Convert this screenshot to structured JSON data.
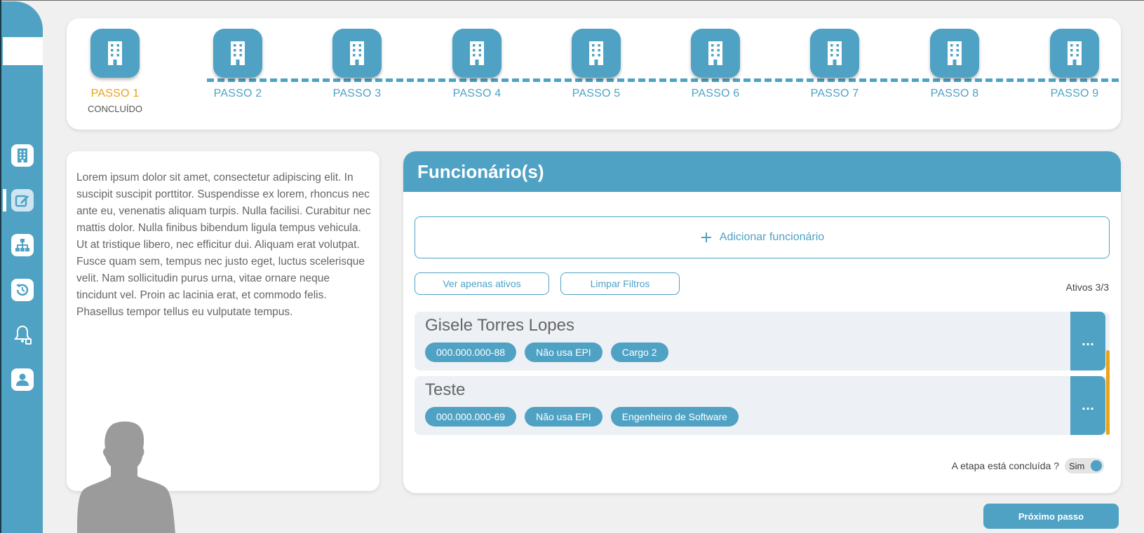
{
  "sidebar": {
    "items": [
      {
        "icon": "building-icon",
        "name": "sidebar-item-company"
      },
      {
        "icon": "edit-icon",
        "name": "sidebar-item-edit",
        "active": true
      },
      {
        "icon": "org-chart-icon",
        "name": "sidebar-item-org-chart"
      },
      {
        "icon": "history-icon",
        "name": "sidebar-item-history"
      },
      {
        "icon": "bell-icon",
        "name": "sidebar-item-notifications"
      },
      {
        "icon": "user-icon",
        "name": "sidebar-item-profile"
      }
    ]
  },
  "stepper": {
    "steps": [
      {
        "label": "PASSO 1",
        "status": "CONCLUÍDO",
        "done": true
      },
      {
        "label": "PASSO 2"
      },
      {
        "label": "PASSO 3"
      },
      {
        "label": "PASSO 4"
      },
      {
        "label": "PASSO 5"
      },
      {
        "label": "PASSO 6"
      },
      {
        "label": "PASSO 7"
      },
      {
        "label": "PASSO 8"
      },
      {
        "label": "PASSO 9"
      }
    ]
  },
  "info": {
    "text": "Lorem ipsum dolor sit amet, consectetur adipiscing elit. In suscipit suscipit porttitor. Suspendisse ex lorem, rhoncus nec ante eu, venenatis aliquam turpis. Nulla facilisi. Curabitur nec mattis dolor. Nulla finibus bibendum ligula tempus vehicula. Ut at tristique libero, nec efficitur dui. Aliquam erat volutpat. Fusce quam sem, tempus nec justo eget, luctus scelerisque velit. Nam sollicitudin purus urna, vitae ornare neque tincidunt vel. Proin ac lacinia erat, et commodo felis. Phasellus tempor tellus eu vulputate tempus."
  },
  "panel": {
    "title": "Funcionário(s)",
    "add_label": "Adicionar funcionário",
    "filter_active_label": "Ver apenas ativos",
    "clear_filters_label": "Limpar Filtros",
    "count_label": "Ativos 3/3",
    "employees": [
      {
        "name": "Gisele Torres Lopes",
        "tags": [
          "000.000.000-88",
          "Não usa EPI",
          "Cargo 2"
        ]
      },
      {
        "name": "Teste",
        "tags": [
          "000.000.000-69",
          "Não usa EPI",
          "Engenheiro de Software"
        ]
      }
    ],
    "menu_label": "...",
    "done_question": "A etapa está concluída ?",
    "done_value": "Sim"
  },
  "next_label": "Próximo passo",
  "colors": {
    "accent": "#4fa2c4",
    "done": "#e8a31a"
  }
}
